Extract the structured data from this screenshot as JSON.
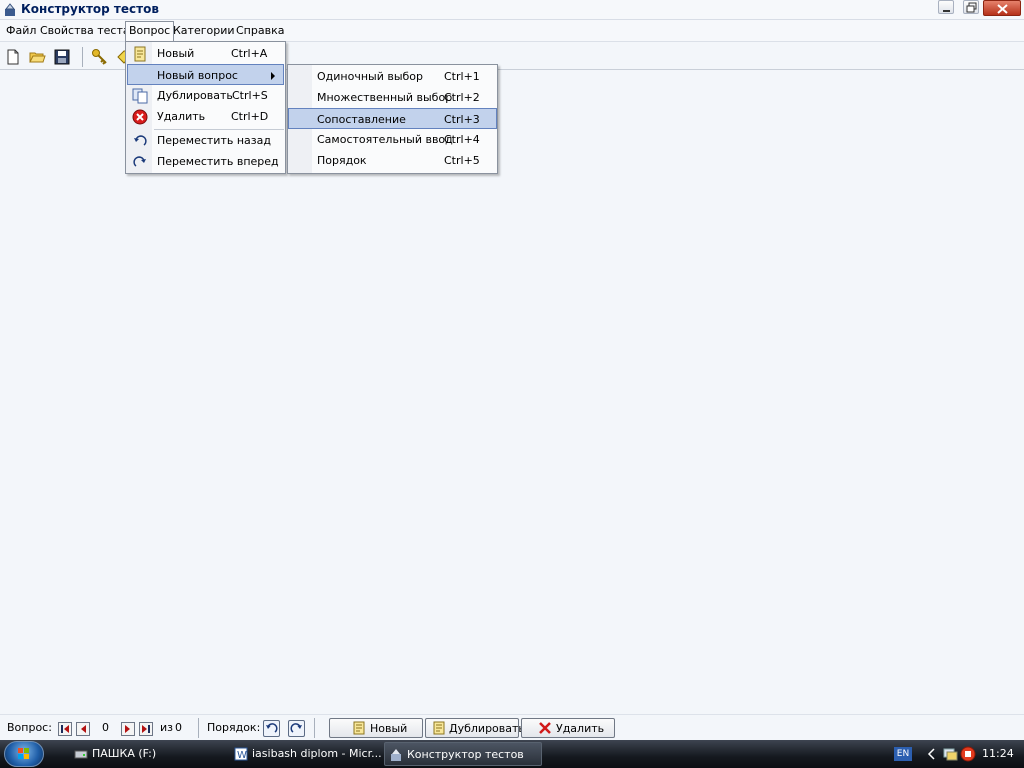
{
  "window": {
    "title": "Конструктор тестов"
  },
  "menubar": {
    "items": [
      {
        "label": "Файл"
      },
      {
        "label": "Свойства теста"
      },
      {
        "label": "Вопрос"
      },
      {
        "label": "Категории"
      },
      {
        "label": "Справка"
      }
    ]
  },
  "question_menu": {
    "items": [
      {
        "label": "Новый",
        "shortcut": "Ctrl+A",
        "icon": "note-icon"
      },
      {
        "label": "Новый вопрос",
        "shortcut": "",
        "icon": "",
        "has_submenu": true
      },
      {
        "label": "Дублировать",
        "shortcut": "Ctrl+S",
        "icon": "copy-icon"
      },
      {
        "label": "Удалить",
        "shortcut": "Ctrl+D",
        "icon": "delete-icon"
      },
      {
        "label": "Переместить назад",
        "shortcut": "",
        "icon": "undo-arrow-icon"
      },
      {
        "label": "Переместить вперед",
        "shortcut": "",
        "icon": "redo-arrow-icon"
      }
    ]
  },
  "new_question_submenu": {
    "items": [
      {
        "label": "Одиночный выбор",
        "shortcut": "Ctrl+1"
      },
      {
        "label": "Множественный выбор",
        "shortcut": "Ctrl+2"
      },
      {
        "label": "Сопоставление",
        "shortcut": "Ctrl+3"
      },
      {
        "label": "Самостоятельный ввод",
        "shortcut": "Ctrl+4"
      },
      {
        "label": "Порядок",
        "shortcut": "Ctrl+5"
      }
    ]
  },
  "statusbar": {
    "question_label": "Вопрос:",
    "current": "0",
    "of_label": "из",
    "total": "0",
    "order_label": "Порядок:",
    "buttons": {
      "new": "Новый",
      "duplicate": "Дублировать",
      "delete": "Удалить"
    }
  },
  "taskbar": {
    "tasks": [
      {
        "label": "ПАШКА (F:)"
      },
      {
        "label": "iasibash diplom - Micr..."
      },
      {
        "label": "Конструктор тестов"
      }
    ],
    "language": "EN",
    "clock": "11:24"
  },
  "colors": {
    "highlight": "#c2d2ec",
    "highlight_border": "#6382be",
    "title_text": "#001f5e",
    "workspace": "#f3f6fa"
  }
}
